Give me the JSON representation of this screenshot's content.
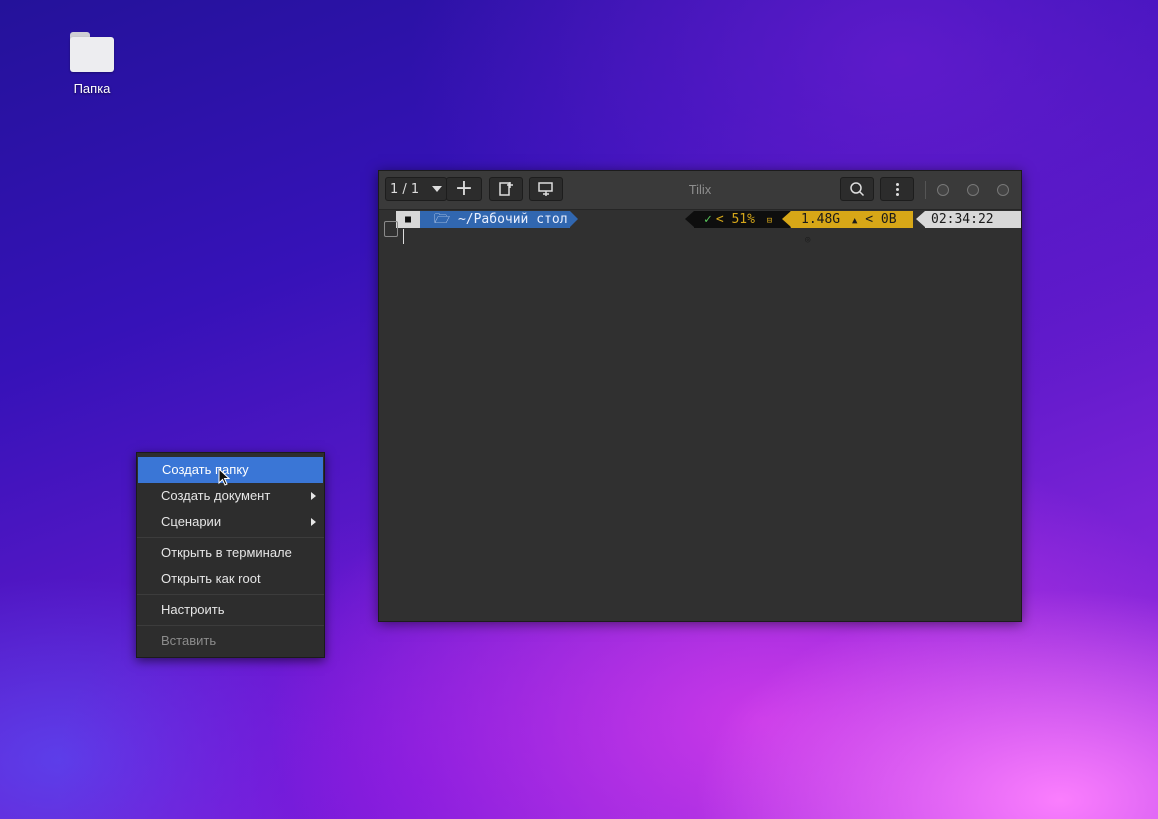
{
  "desktop": {
    "icons": [
      {
        "label": "Папка",
        "icon": "folder-icon"
      }
    ]
  },
  "terminal": {
    "title": "Tilix",
    "session_label": "1 / 1",
    "prompt": {
      "host_glyph": "■",
      "path": "🗁 ~/Рабочий стол",
      "status_check": "✓",
      "battery": "51%",
      "memory": "1.48G",
      "disk": "0B",
      "time": "02:34:22"
    }
  },
  "context_menu": {
    "items": [
      {
        "label": "Создать папку",
        "active": true
      },
      {
        "label": "Создать документ",
        "submenu": true
      },
      {
        "label": "Сценарии",
        "submenu": true
      },
      {
        "label": "Открыть в терминале"
      },
      {
        "label": "Открыть как root"
      },
      {
        "label": "Настроить"
      },
      {
        "label": "Вставить",
        "disabled": true
      }
    ]
  },
  "colors": {
    "menu_highlight": "#3a76d6",
    "prompt_path": "#3167b0",
    "prompt_yellow": "#d7a717"
  }
}
